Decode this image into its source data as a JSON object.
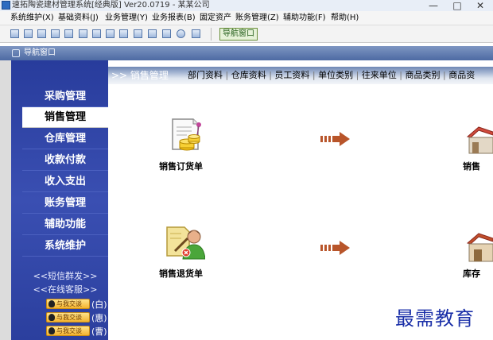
{
  "window": {
    "title": "速拓陶瓷建材管理系统[经典版] Ver20.0719 - 某某公司",
    "minimize": "—",
    "maximize": "□",
    "close": "✕"
  },
  "menu": [
    {
      "label": "系统维护(X)"
    },
    {
      "label": "基础资料(J)"
    },
    {
      "label": "业务管理(Y)"
    },
    {
      "label": "业务报表(B)"
    },
    {
      "label": "固定资产"
    },
    {
      "label": "账务管理(Z)"
    },
    {
      "label": "辅助功能(F)"
    },
    {
      "label": "帮助(H)"
    }
  ],
  "toolbar": {
    "nav_button": "导航窗口"
  },
  "panel": {
    "title": "导航窗口"
  },
  "sidebar": {
    "items": [
      {
        "label": "采购管理",
        "active": false
      },
      {
        "label": "销售管理",
        "active": true
      },
      {
        "label": "仓库管理",
        "active": false
      },
      {
        "label": "收款付款",
        "active": false
      },
      {
        "label": "收入支出",
        "active": false
      },
      {
        "label": "账务管理",
        "active": false
      },
      {
        "label": "辅助功能",
        "active": false
      },
      {
        "label": "系统维护",
        "active": false
      }
    ],
    "sms_link": "<<短信群发>>",
    "service_link": "<<在线客服>>",
    "qq": [
      {
        "badge": "与我交谈",
        "suffix": "(白)"
      },
      {
        "badge": "与我交谈",
        "suffix": "(惠)"
      },
      {
        "badge": "与我交谈",
        "suffix": "(曹)"
      }
    ]
  },
  "main": {
    "section_title": ">> 销售管理",
    "tabs": [
      {
        "label": "部门资料"
      },
      {
        "label": "仓库资料"
      },
      {
        "label": "员工资料"
      },
      {
        "label": "单位类别"
      },
      {
        "label": "往来单位"
      },
      {
        "label": "商品类别"
      },
      {
        "label": "商品资"
      }
    ],
    "flow": [
      {
        "label": "销售订货单"
      },
      {
        "label": "销售"
      },
      {
        "label": "销售退货单"
      },
      {
        "label": "库存"
      }
    ]
  },
  "watermark": "最需教育",
  "colors": {
    "sidebar": "#2f45a8",
    "arrow": "#b8552a",
    "watermark": "#1a2fa8"
  }
}
